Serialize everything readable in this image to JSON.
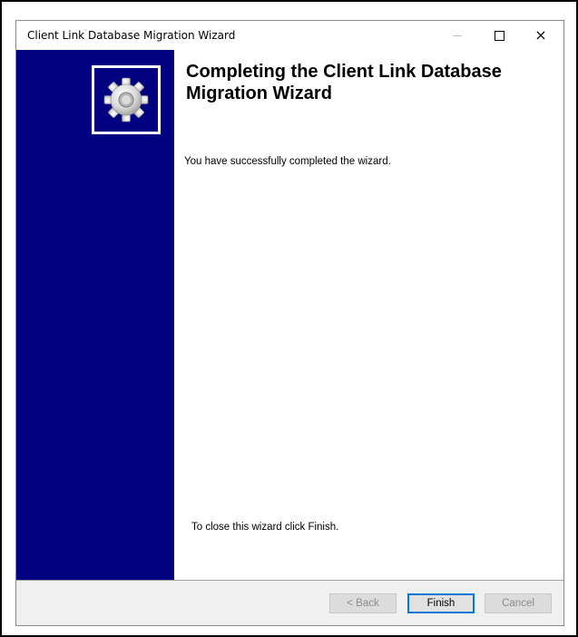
{
  "window": {
    "title": "Client Link Database Migration Wizard",
    "controls": {
      "minimize": "minimize",
      "maximize": "maximize",
      "close": "×"
    }
  },
  "banner": {
    "color": "#000080",
    "logo_icon": "gear-icon"
  },
  "content": {
    "heading": "Completing the Client Link Database Migration Wizard",
    "message": "You have successfully completed the wizard.",
    "footer_message": "To close this wizard click Finish."
  },
  "buttons": {
    "back": "< Back",
    "finish": "Finish",
    "cancel": "Cancel"
  },
  "state": {
    "back_enabled": false,
    "finish_enabled": true,
    "cancel_enabled": false
  }
}
